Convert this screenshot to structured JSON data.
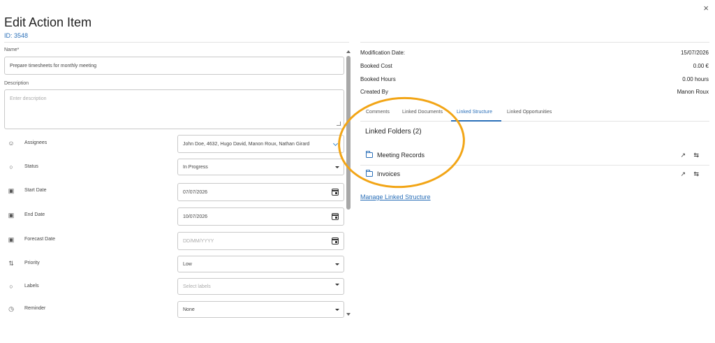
{
  "header": {
    "title": "Edit Action Item",
    "id_label": "ID: 3548",
    "close_glyph": "×"
  },
  "form": {
    "name_label": "Name*",
    "name_value": "Prepare timesheets for monthly meeting",
    "description_label": "Description",
    "description_placeholder": "Enter description",
    "fields": [
      {
        "label": "Assignees",
        "value": "John Doe, 4632, Hugo David, Manon Roux, Nathan Girard",
        "icon": "people-icon",
        "control": "multiselect"
      },
      {
        "label": "Status",
        "value": "In Progress",
        "icon": "circle-icon",
        "control": "select"
      },
      {
        "label": "Start Date",
        "value": "07/07/2026",
        "icon": "calendar-icon",
        "control": "date"
      },
      {
        "label": "End Date",
        "value": "10/07/2026",
        "icon": "calendar-icon",
        "control": "date"
      },
      {
        "label": "Forecast Date",
        "value": "",
        "placeholder": "DD/MM/YYYY",
        "icon": "calendar-icon",
        "control": "date"
      },
      {
        "label": "Priority",
        "value": "Low",
        "icon": "sort-arrows-icon",
        "control": "select"
      },
      {
        "label": "Labels",
        "value": "",
        "placeholder": "Select labels",
        "icon": "circle-icon",
        "control": "select"
      },
      {
        "label": "Reminder",
        "value": "None",
        "icon": "clock-icon",
        "control": "select"
      }
    ]
  },
  "details": [
    {
      "key": "Modification Date:",
      "value": "15/07/2026"
    },
    {
      "key": "Booked Cost",
      "value": "0.00 €"
    },
    {
      "key": "Booked Hours",
      "value": "0.00 hours"
    },
    {
      "key": "Created By",
      "value": "Manon Roux"
    }
  ],
  "tabs": [
    {
      "label": "Comments",
      "active": false
    },
    {
      "label": "Linked Documents",
      "active": false
    },
    {
      "label": "Linked Structure",
      "active": true
    },
    {
      "label": "Linked Opportunities",
      "active": false
    }
  ],
  "linked": {
    "title": "Linked Folders (2)",
    "folders": [
      {
        "name": "Meeting Records"
      },
      {
        "name": "Invoices"
      }
    ],
    "manage_link": "Manage Linked Structure"
  },
  "colors": {
    "accent": "#2a6fb8",
    "highlight": "#f2a516"
  }
}
